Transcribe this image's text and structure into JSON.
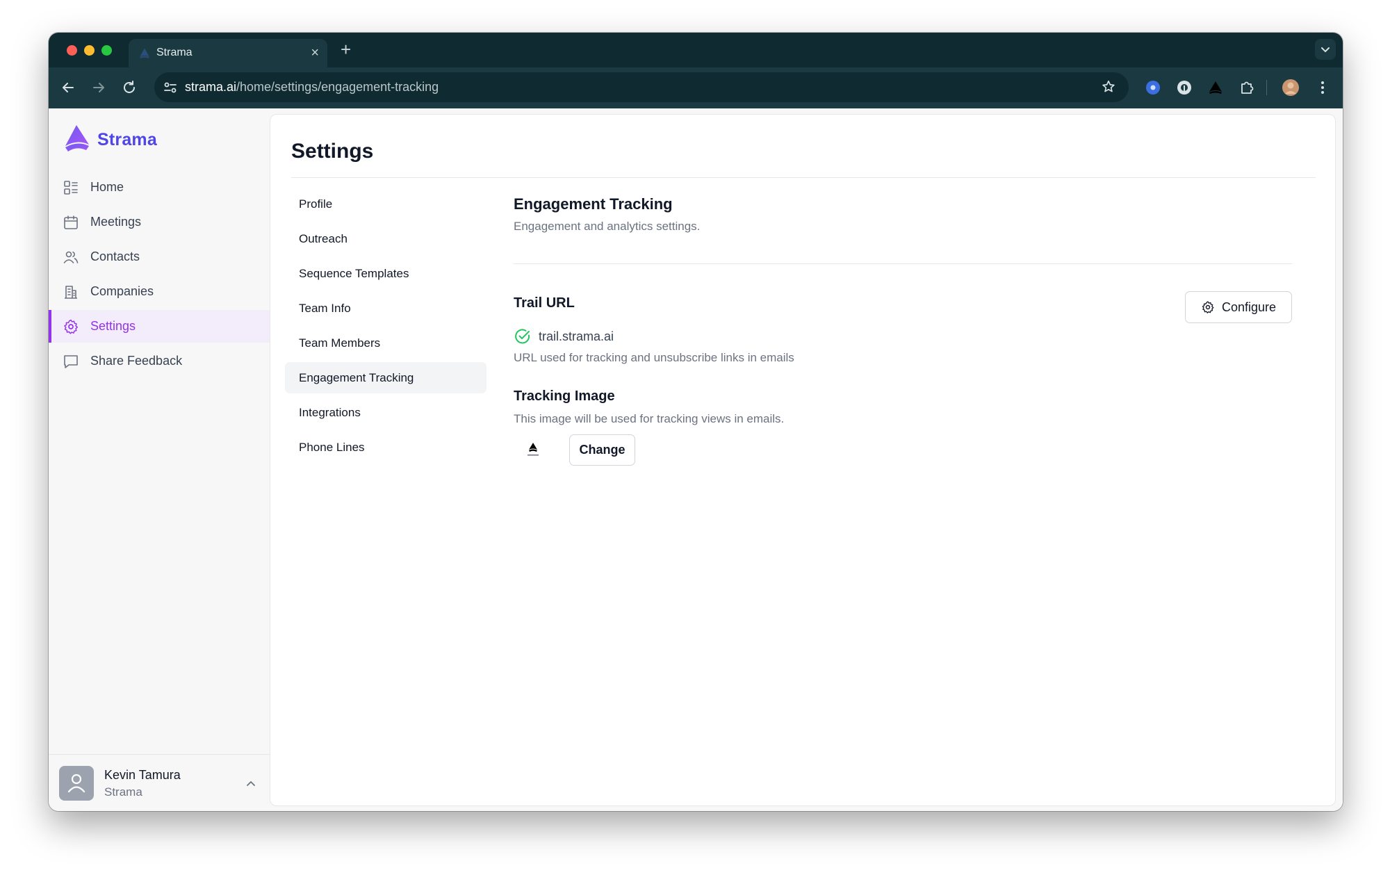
{
  "browser": {
    "tab_title": "Strama",
    "url_host": "strama.ai",
    "url_path": "/home/settings/engagement-tracking"
  },
  "brand": {
    "name": "Strama",
    "color": "#4f46e5"
  },
  "sidebar": {
    "items": [
      {
        "label": "Home",
        "icon": "dashboard-icon"
      },
      {
        "label": "Meetings",
        "icon": "calendar-icon"
      },
      {
        "label": "Contacts",
        "icon": "users-icon"
      },
      {
        "label": "Companies",
        "icon": "building-icon"
      },
      {
        "label": "Settings",
        "icon": "gear-icon",
        "active": true
      },
      {
        "label": "Share Feedback",
        "icon": "chat-bubble-icon"
      }
    ],
    "active_color": "#9333ea"
  },
  "user": {
    "name": "Kevin Tamura",
    "org": "Strama"
  },
  "page": {
    "title": "Settings"
  },
  "settings_nav": {
    "items": [
      "Profile",
      "Outreach",
      "Sequence Templates",
      "Team Info",
      "Team Members",
      "Engagement Tracking",
      "Integrations",
      "Phone Lines"
    ],
    "active": "Engagement Tracking"
  },
  "engagement": {
    "title": "Engagement Tracking",
    "subtitle": "Engagement and analytics settings.",
    "trail": {
      "title": "Trail URL",
      "value": "trail.strama.ai",
      "status_icon": "check-circle-icon",
      "status_color": "#22c55e",
      "help": "URL used for tracking and unsubscribe links in emails",
      "configure_label": "Configure"
    },
    "tracking_image": {
      "title": "Tracking Image",
      "help": "This image will be used for tracking views in emails.",
      "change_label": "Change"
    }
  }
}
